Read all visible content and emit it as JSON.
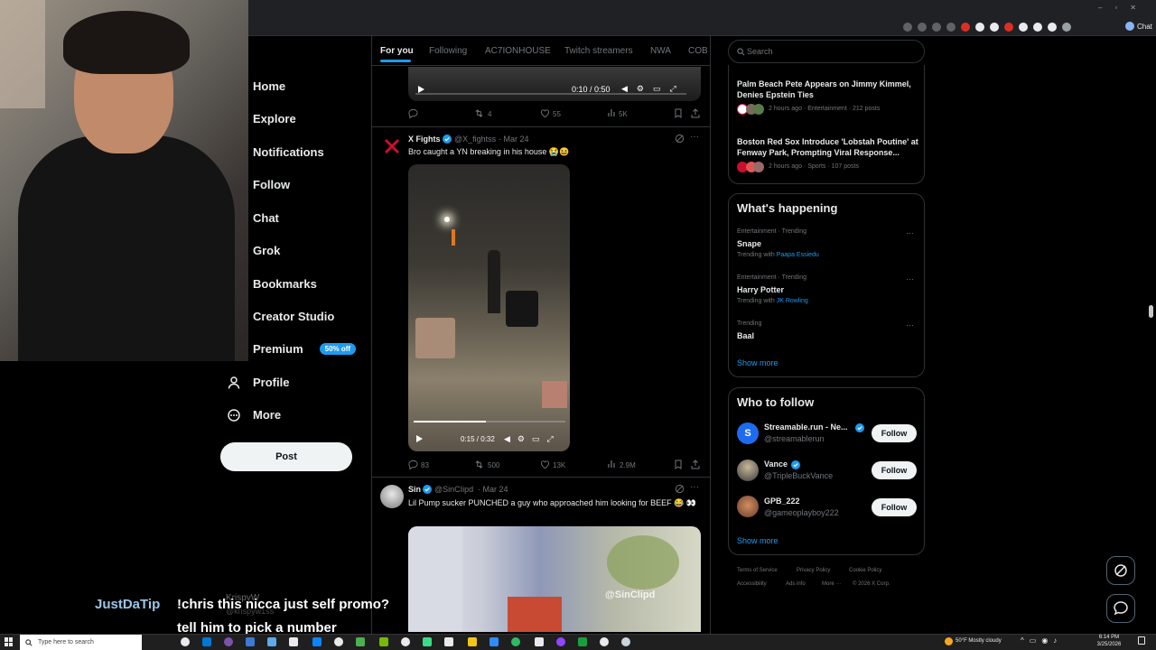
{
  "nav": {
    "items": [
      {
        "label": "Home",
        "icon": "home-icon"
      },
      {
        "label": "Explore",
        "icon": "search-icon"
      },
      {
        "label": "Notifications",
        "icon": "bell-icon"
      },
      {
        "label": "Follow",
        "icon": "follow-icon"
      },
      {
        "label": "Chat",
        "icon": "chat-icon"
      },
      {
        "label": "Grok",
        "icon": "grok-icon"
      },
      {
        "label": "Bookmarks",
        "icon": "bookmark-icon"
      },
      {
        "label": "Creator Studio",
        "icon": "studio-icon"
      },
      {
        "label": "Premium",
        "icon": "premium-icon",
        "badge": "50% off"
      },
      {
        "label": "Profile",
        "icon": "person-icon"
      },
      {
        "label": "More",
        "icon": "more-circle-icon"
      }
    ],
    "post_label": "Post"
  },
  "tabs": [
    "For you",
    "Following",
    "AC7IONHOUSE",
    "Twitch streamers",
    "NWA",
    "COBE"
  ],
  "search": {
    "placeholder": "Search"
  },
  "tweet0": {
    "time": "0:10 / 0:50",
    "replies": "",
    "retweets": "4",
    "likes": "55",
    "views": "5K"
  },
  "tweet1": {
    "name": "X Fights",
    "handle": "@X_fightss",
    "date": "· Mar 24",
    "text": "Bro caught a YN breaking in his house 😭😆",
    "time": "0:15 / 0:32",
    "replies": "83",
    "retweets": "500",
    "likes": "13K",
    "views": "2.9M"
  },
  "tweet2": {
    "name": "Sin",
    "handle": "@SinCIipd",
    "date": "· Mar 24",
    "text": "Lil Pump sucker PUNCHED a guy who approached him looking for BEEF 😂 👀",
    "watermark": "@SinClipd"
  },
  "news": [
    {
      "title": "Palm Beach Pete Appears on Jimmy Kimmel, Denies Epstein Ties",
      "meta": "2 hours ago · Entertainment · 212 posts"
    },
    {
      "title": "Boston Red Sox Introduce 'Lobstah Poutine' at Fenway Park, Prompting Viral Response...",
      "meta": "2 hours ago · Sports · 107 posts"
    }
  ],
  "happening": {
    "heading": "What's happening",
    "trends": [
      {
        "meta": "Entertainment · Trending",
        "title": "Snape",
        "with_prefix": "Trending with",
        "with": "Paapa Essiedu"
      },
      {
        "meta": "Entertainment · Trending",
        "title": "Harry Potter",
        "with_prefix": "Trending with",
        "with": "JK Rowling"
      },
      {
        "meta": "Trending",
        "title": "Baal",
        "with_prefix": "",
        "with": ""
      }
    ],
    "show_more": "Show more"
  },
  "who_to_follow": {
    "heading": "Who to follow",
    "users": [
      {
        "name": "Streamable.run - Ne...",
        "handle": "@streamablerun"
      },
      {
        "name": "Vance",
        "handle": "@TripleBuckVance"
      },
      {
        "name": "GPB_222",
        "handle": "@gameoplayboy222"
      }
    ],
    "follow_label": "Follow",
    "show_more": "Show more"
  },
  "footer": [
    "Terms of Service",
    "Privacy Policy",
    "Cookie Policy",
    "Accessibility",
    "Ads info",
    "More ···",
    "© 2026 X Corp."
  ],
  "chat": {
    "user": "JustDaTip",
    "message_line1": "!chris this nicca just self promo?",
    "message_line2": "tell him to pick a number",
    "ghost_name": "KrispyW",
    "ghost_handle": "@krispyw1ss"
  },
  "taskbar": {
    "search_placeholder": "Type here to search",
    "weather": "50°F  Mostly cloudy",
    "time": "6:14 PM",
    "date": "3/25/2026"
  },
  "browser": {
    "profile_label": "Chat"
  },
  "colors": {
    "accent": "#1d9bf0",
    "background": "#000000",
    "border": "#2f3336"
  }
}
